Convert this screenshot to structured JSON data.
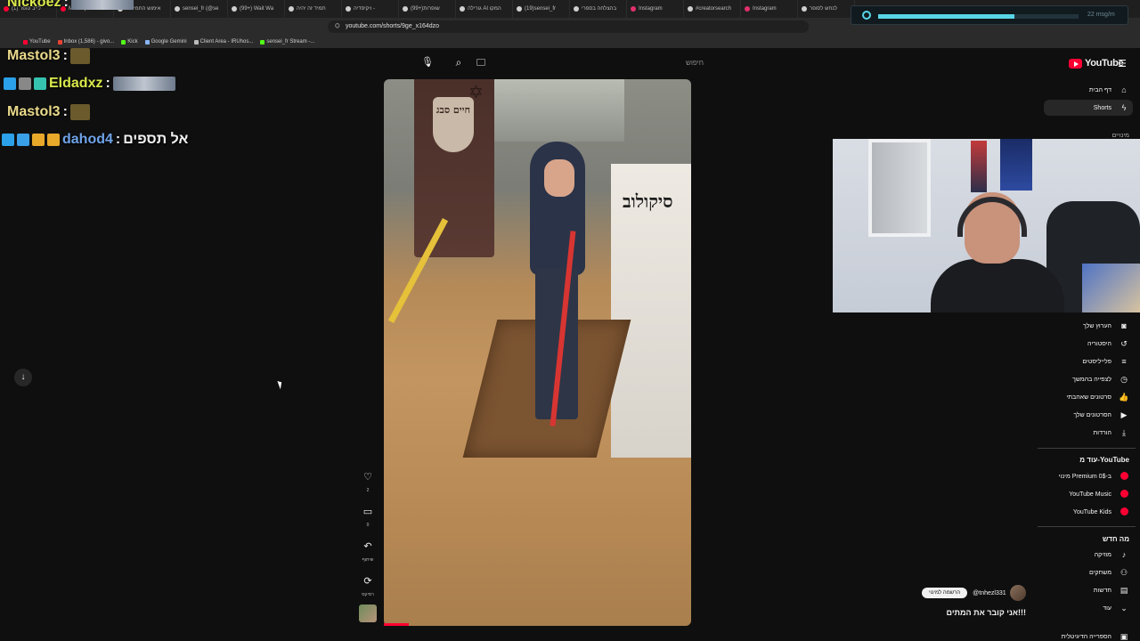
{
  "browser": {
    "tabs": [
      {
        "label": "(1) לייב סופר",
        "color": "#ff0033"
      },
      {
        "label": "Mashup",
        "color": "#ff0033"
      },
      {
        "label": "אימוש החמיצות",
        "color": "#d0d0d0"
      },
      {
        "label": "sensei_fr (@se",
        "color": "#d0d0d0"
      },
      {
        "label": "(99+) Wait Wa",
        "color": "#d0d0d0"
      },
      {
        "label": "תמיד זה יהיה",
        "color": "#d0d0d0"
      },
      {
        "label": "ויקיפדיה -",
        "color": "#d0d0d0"
      },
      {
        "label": "(99+)שופרות",
        "color": "#d0d0d0"
      },
      {
        "label": "גורילה AI המקו",
        "color": "#d0d0d0"
      },
      {
        "label": "(19)sensei_fr",
        "color": "#d0d0d0"
      },
      {
        "label": "בהצלחה בספרי",
        "color": "#d0d0d0"
      },
      {
        "label": "Instagram",
        "color": "#e1306c"
      },
      {
        "label": "#creatorsearch",
        "color": "#d0d0d0"
      },
      {
        "label": "Instagram",
        "color": "#e1306c"
      },
      {
        "label": "לנחש לסופר",
        "color": "#d0d0d0"
      }
    ],
    "url": "youtube.com/shorts/9ge_x164dzo",
    "bookmarks": [
      {
        "label": "YouTube",
        "color": "#ff0033"
      },
      {
        "label": "Inbox (1,586) - givo...",
        "color": "#ea4335"
      },
      {
        "label": "Kick",
        "color": "#53fc18"
      },
      {
        "label": "Google Gemini",
        "color": "#8ab4f8"
      },
      {
        "label": "Client Area - IRUhos...",
        "color": "#bbbbbb"
      },
      {
        "label": "sensei_fr Stream -...",
        "color": "#53fc18"
      }
    ]
  },
  "media_widget": {
    "tag": "22 msg/m",
    "progress": 0.68
  },
  "chat": [
    {
      "user": "Nickoez",
      "sep": ":",
      "message": "",
      "color": "#d9e84a",
      "emote": "picture"
    },
    {
      "user": "Mastol3",
      "sep": ":",
      "message": "",
      "color": "#e9d98a",
      "emote": "sticker"
    },
    {
      "user": "Eldadxz",
      "sep": ":",
      "message": "",
      "color": "#d9e84a",
      "emote": "picture"
    },
    {
      "user": "Mastol3",
      "sep": ":",
      "message": "",
      "color": "#e9d98a",
      "emote": "sticker"
    },
    {
      "user": "dahod4",
      "sep": ":",
      "message": "אל תספים",
      "color": "#6fa3e8",
      "emote": ""
    }
  ],
  "youtube": {
    "logo_text": "YouTube",
    "search_placeholder": "חיפוש",
    "video": {
      "stone_text": "חיים סבג",
      "wall_text": "סיקולוב",
      "progress": 0.08
    },
    "actions": [
      {
        "name": "like",
        "icon": "♡",
        "label": "2"
      },
      {
        "name": "comment",
        "icon": "▭",
        "label": "0"
      },
      {
        "name": "share",
        "icon": "↶",
        "label": "שיתוף"
      },
      {
        "name": "remix",
        "icon": "⟳",
        "label": "רמיקס"
      }
    ],
    "sidebar": {
      "top": [
        {
          "label": "דף הבית",
          "icon": "⌂"
        },
        {
          "label": "Shorts",
          "icon": "ϟ"
        }
      ],
      "subscriptions_label": "מינויים",
      "you": [
        {
          "label": "הערוץ שלך",
          "icon": "◙"
        },
        {
          "label": "היסטוריה",
          "icon": "↺"
        },
        {
          "label": "פלייליסטים",
          "icon": "≡"
        },
        {
          "label": "לצפייה בהמשך",
          "icon": "◷"
        },
        {
          "label": "סרטונים שאהבתי",
          "icon": "👍"
        },
        {
          "label": "הסרטונים שלך",
          "icon": "▶"
        },
        {
          "label": "הורדות",
          "icon": "⤓"
        }
      ],
      "more_heading": "עוד מ-YouTube",
      "more": [
        {
          "label": "מינוי Premium ב-0$",
          "icon": "red"
        },
        {
          "label": "YouTube Music",
          "icon": "red"
        },
        {
          "label": "YouTube Kids",
          "icon": "red"
        }
      ],
      "explore_heading": "מה חדש",
      "explore": [
        {
          "label": "מוזיקה",
          "icon": "♪"
        },
        {
          "label": "משחקים",
          "icon": "⚇"
        },
        {
          "label": "חדשות",
          "icon": "▤"
        },
        {
          "label": "עוד",
          "icon": "⌄"
        }
      ],
      "bottom_label": "הספרייה הדיגיטלית"
    },
    "channel": {
      "handle": "@tnhezl331",
      "subscribe_label": "הרשמה למינוי"
    },
    "title": "אני קובר את המתים!!!"
  }
}
